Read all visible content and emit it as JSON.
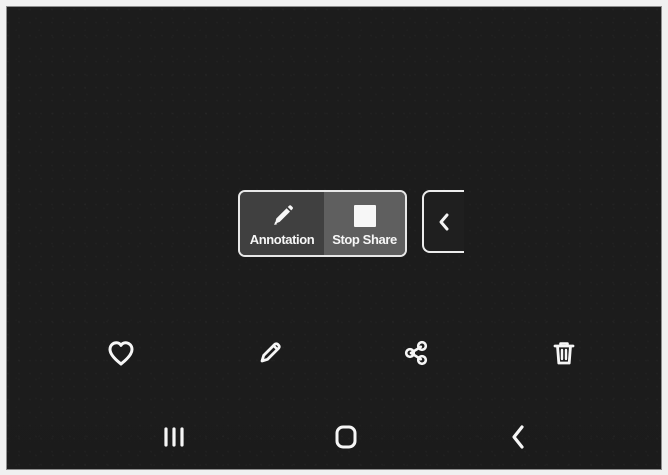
{
  "screen": {
    "background_color": "#1c1c1c",
    "foreground_color": "#f5f5f5"
  },
  "floating_toolbar": {
    "annotation_label": "Annotation",
    "stop_share_label": "Stop Share",
    "annotation_icon": "pencil-icon",
    "stop_share_icon": "stop-square-icon",
    "collapse_icon": "chevron-left-icon"
  },
  "bottom_actions": [
    {
      "icon": "heart-outline-icon"
    },
    {
      "icon": "pencil-outline-icon"
    },
    {
      "icon": "share-icon"
    },
    {
      "icon": "trash-icon"
    }
  ],
  "navigation_bar": [
    {
      "icon": "recent-apps-icon"
    },
    {
      "icon": "home-icon"
    },
    {
      "icon": "back-icon"
    }
  ]
}
